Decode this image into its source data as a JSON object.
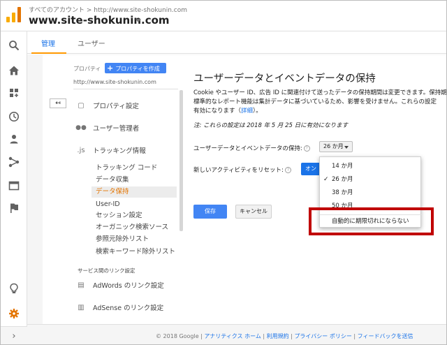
{
  "header": {
    "crumb": "すべてのアカウント > http://www.site-shokunin.com",
    "title": "www.site-shokunin.com"
  },
  "rail": {
    "icons": [
      "search-icon",
      "home-icon",
      "dashboard-icon",
      "clock-icon",
      "person-icon",
      "share-icon",
      "window-icon",
      "flag-icon",
      "lightbulb-icon",
      "gear-icon"
    ],
    "expand": "›"
  },
  "tabs": [
    {
      "label": "管理",
      "active": true
    },
    {
      "label": "ユーザー",
      "active": false
    }
  ],
  "property": {
    "label": "プロパティ",
    "create_button": "プロパティを作成",
    "create_plus": "+",
    "url": "http://www.site-shokunin.com",
    "back": "↤"
  },
  "nav": {
    "sections": [
      {
        "label": "プロパティ設定",
        "icon": "▢"
      },
      {
        "label": "ユーザー管理者",
        "icon": "👥"
      },
      {
        "label": "トラッキング情報",
        "icon": ".js"
      }
    ],
    "sub_items": [
      "トラッキング コード",
      "データ収集",
      "データ保持",
      "User-ID",
      "セッション設定",
      "オーガニック検索ソース",
      "参照元除外リスト",
      "検索キーワード除外リスト"
    ],
    "active_sub": "データ保持",
    "link_heading": "サービス間のリンク設定",
    "links": [
      {
        "label": "AdWords のリンク設定",
        "icon": "▤"
      },
      {
        "label": "AdSense のリンク設定",
        "icon": "▥"
      }
    ]
  },
  "content": {
    "title": "ユーザーデータとイベントデータの保持",
    "desc_line1": "Cookie やユーザー ID、広告 ID に関連付けて送ったデータの保持期間は変更できます。保持期",
    "desc_line2": "標準的なレポート機能は集計データに基づいているため、影響を受けません。これらの設定",
    "desc_line3_pre": "有効になります（",
    "desc_link": "詳細",
    "desc_line3_post": "）。",
    "note": "注: これらの設定は 2018 年 5 月 25 日に有効になります",
    "retention_label": "ユーザーデータとイベントデータの保持:",
    "retention_value": "26 か月",
    "reset_label": "新しいアクティビティをリセット:",
    "reset_toggle": "オン",
    "help": "?"
  },
  "dropdown": {
    "options": [
      "14 か月",
      "26 か月",
      "38 か月",
      "50 か月"
    ],
    "selected": "26 か月",
    "check": "✓",
    "never_expire": "自動的に期限切れにならない"
  },
  "buttons": {
    "save": "保存",
    "cancel": "キャンセル"
  },
  "footer": {
    "copyright": "© 2018 Google",
    "links": [
      "アナリティクス ホーム",
      "利用規約",
      "プライバシー ポリシー",
      "フィードバックを送信"
    ],
    "separator": " | "
  },
  "colors": {
    "accent_blue": "#4285f4",
    "logo_orange": "#f9ab00",
    "logo_dark": "#e37400",
    "tab_underline": "#ff9800",
    "highlight_box": "#c00000",
    "active_text": "#e37400"
  }
}
